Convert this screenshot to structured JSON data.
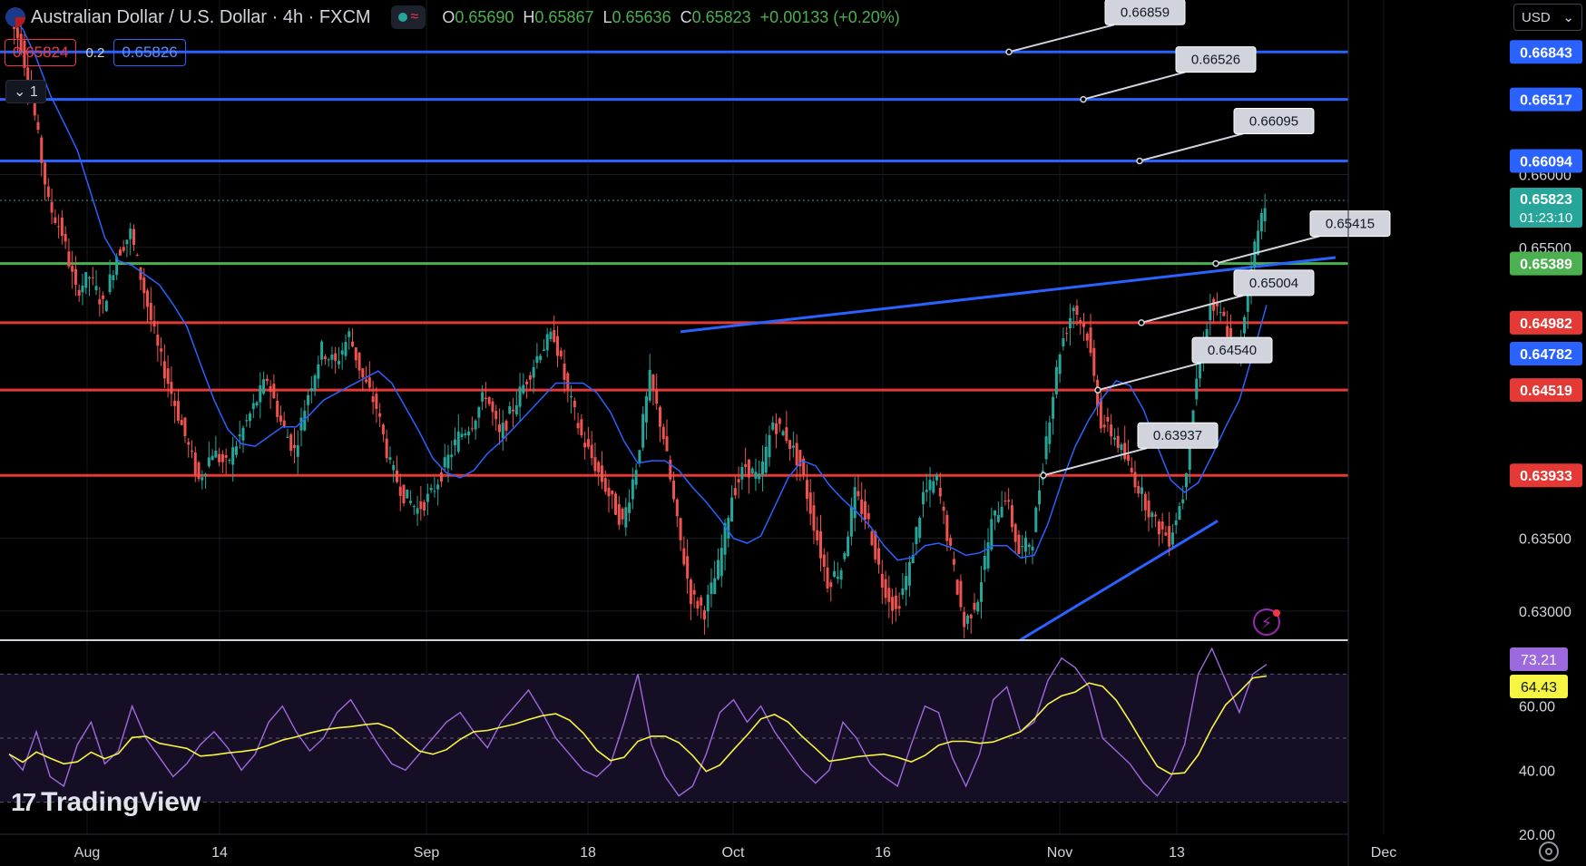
{
  "header": {
    "symbol_title": "Australian Dollar / U.S. Dollar · 4h · FXCM",
    "open_label": "O",
    "open": "0.65690",
    "high_label": "H",
    "high": "0.65867",
    "low_label": "L",
    "low": "0.65636",
    "close_label": "C",
    "close": "0.65823",
    "change": "+0.00133 (+0.20%)"
  },
  "trading": {
    "bid": "0.65824",
    "spread": "0.2",
    "ask": "0.65826"
  },
  "collapse_label": "1",
  "currency_selector": "USD",
  "branding": "TradingView",
  "colors": {
    "up": "#26a69a",
    "down": "#ef5350",
    "support": "#e53935",
    "resistance": "#2962ff",
    "pivot": "#4caf50",
    "ma": "#2962ff",
    "rsi": "#9c6ade",
    "rsi_ma": "#f5f542"
  },
  "chart_data": {
    "type": "candlestick",
    "symbol": "AUDUSD",
    "timeframe": "4h",
    "price_axis": {
      "range": [
        0.628,
        0.672
      ],
      "ticks": [
        "0.66000",
        "0.65500",
        "0.63500",
        "0.63000"
      ]
    },
    "time_axis": {
      "labels": [
        "Aug",
        "14",
        "Sep",
        "18",
        "Oct",
        "16",
        "Nov",
        "13",
        "Dec"
      ]
    },
    "close_series": [
      0.671,
      0.669,
      0.664,
      0.658,
      0.656,
      0.652,
      0.653,
      0.651,
      0.6545,
      0.656,
      0.652,
      0.648,
      0.645,
      0.642,
      0.639,
      0.641,
      0.64,
      0.642,
      0.644,
      0.646,
      0.643,
      0.641,
      0.645,
      0.648,
      0.647,
      0.649,
      0.646,
      0.644,
      0.64,
      0.638,
      0.637,
      0.638,
      0.64,
      0.642,
      0.643,
      0.645,
      0.642,
      0.644,
      0.646,
      0.648,
      0.649,
      0.645,
      0.642,
      0.64,
      0.638,
      0.636,
      0.64,
      0.646,
      0.642,
      0.636,
      0.631,
      0.63,
      0.633,
      0.638,
      0.64,
      0.639,
      0.643,
      0.642,
      0.64,
      0.636,
      0.632,
      0.633,
      0.638,
      0.636,
      0.632,
      0.63,
      0.633,
      0.638,
      0.639,
      0.634,
      0.629,
      0.631,
      0.636,
      0.638,
      0.634,
      0.635,
      0.642,
      0.648,
      0.651,
      0.649,
      0.643,
      0.642,
      0.64,
      0.638,
      0.636,
      0.635,
      0.638,
      0.646,
      0.651,
      0.65,
      0.647,
      0.654,
      0.6582
    ],
    "horizontal_levels": [
      {
        "price": 0.66843,
        "label": "0.66843",
        "color": "#2962ff",
        "callout": "0.66859"
      },
      {
        "price": 0.66517,
        "label": "0.66517",
        "color": "#2962ff",
        "callout": "0.66526"
      },
      {
        "price": 0.66094,
        "label": "0.66094",
        "color": "#2962ff",
        "callout": "0.66095"
      },
      {
        "price": 0.65389,
        "label": "0.65389",
        "color": "#4caf50",
        "callout": "0.65415"
      },
      {
        "price": 0.64982,
        "label": "0.64982",
        "color": "#e53935",
        "callout": "0.65004"
      },
      {
        "price": 0.64519,
        "label": "0.64519",
        "color": "#e53935",
        "callout": "0.64540"
      },
      {
        "price": 0.63933,
        "label": "0.63933",
        "color": "#e53935",
        "callout": "0.63937"
      }
    ],
    "last_price": {
      "label": "0.65823",
      "countdown": "01:23:10"
    },
    "ma_last_label": "0.64782",
    "rsi": {
      "range": [
        20,
        80
      ],
      "ticks": [
        "60.00",
        "40.00",
        "20.00"
      ],
      "band": [
        30,
        70
      ],
      "value_label": "73.21",
      "ma_label": "64.43",
      "values": [
        45,
        40,
        52,
        38,
        35,
        48,
        55,
        42,
        46,
        60,
        50,
        44,
        38,
        42,
        48,
        52,
        47,
        40,
        45,
        55,
        60,
        52,
        46,
        50,
        58,
        62,
        55,
        48,
        42,
        40,
        45,
        50,
        55,
        58,
        52,
        47,
        55,
        60,
        65,
        58,
        50,
        45,
        40,
        38,
        42,
        55,
        70,
        48,
        38,
        32,
        35,
        45,
        58,
        62,
        55,
        60,
        52,
        46,
        40,
        36,
        40,
        55,
        50,
        42,
        38,
        35,
        48,
        60,
        58,
        44,
        35,
        45,
        62,
        66,
        52,
        55,
        68,
        75,
        72,
        66,
        50,
        46,
        42,
        36,
        32,
        38,
        48,
        70,
        78,
        68,
        58,
        70,
        73
      ]
    }
  }
}
